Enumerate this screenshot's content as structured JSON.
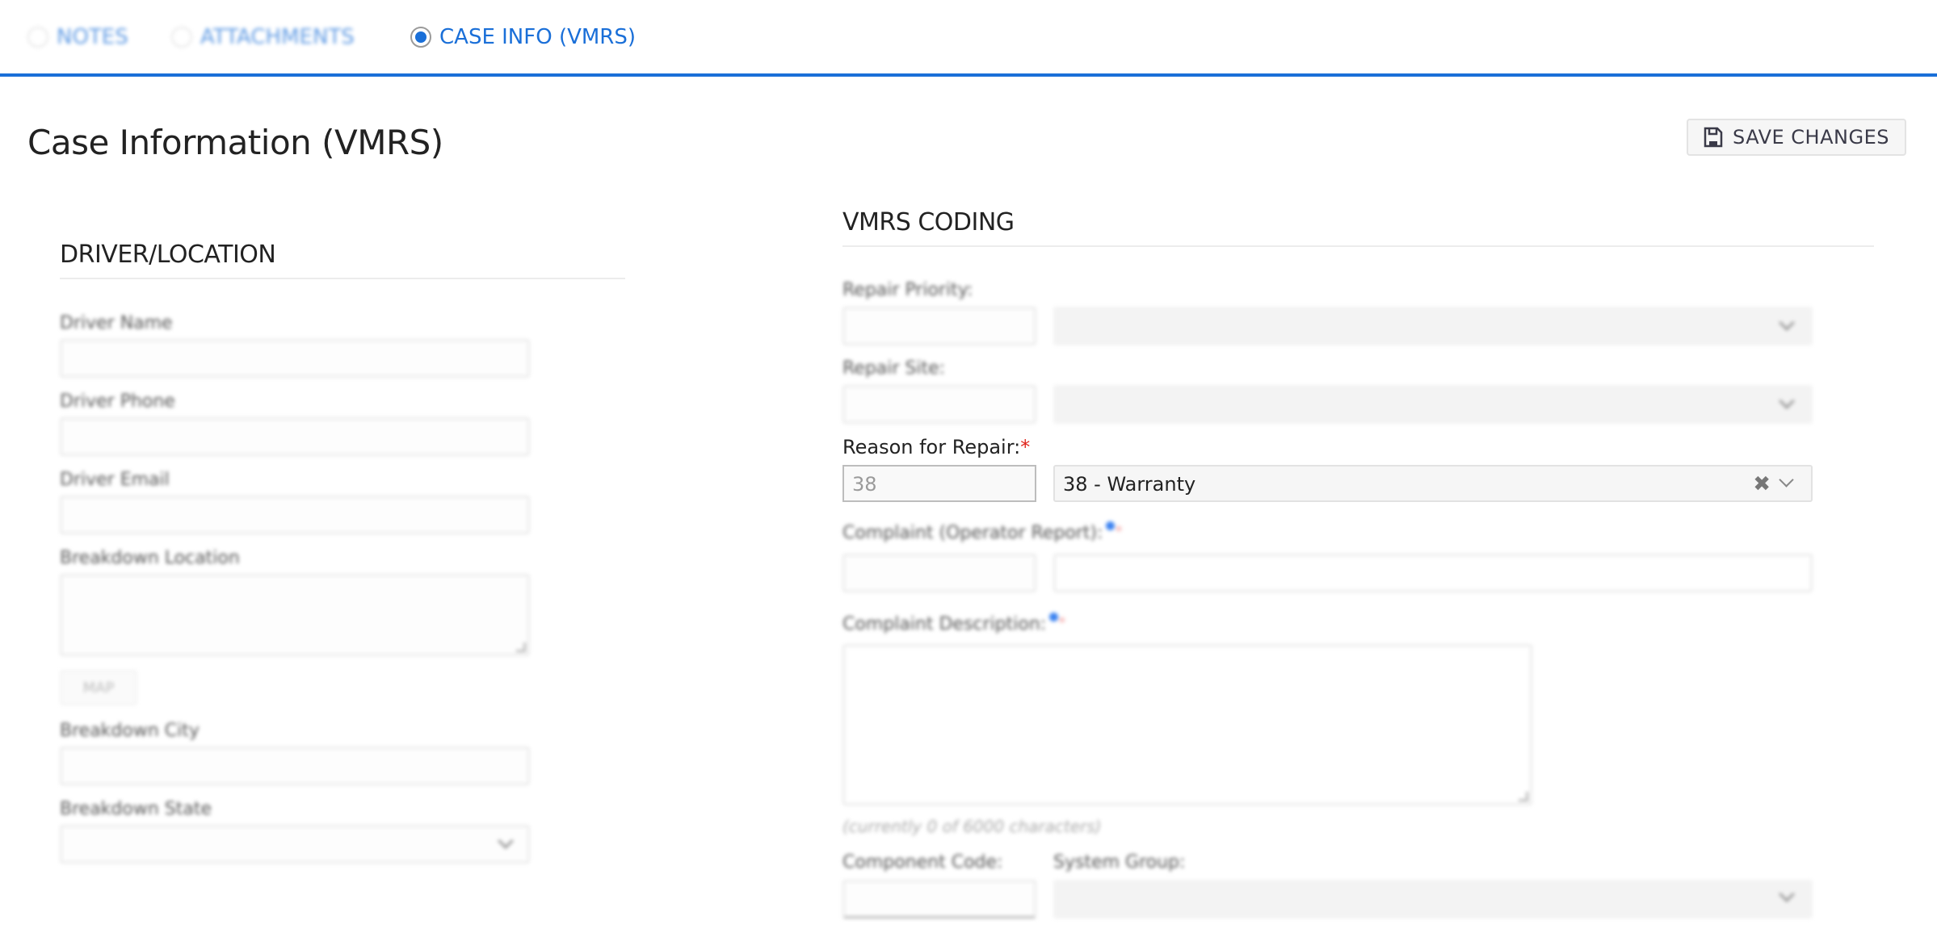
{
  "tabs": [
    {
      "label": "NOTES",
      "selected": false
    },
    {
      "label": "ATTACHMENTS",
      "selected": false
    },
    {
      "label": "CASE INFO (VMRS)",
      "selected": true
    }
  ],
  "page": {
    "title": "Case Information (VMRS)",
    "save_label": "SAVE CHANGES",
    "save_icon": "floppy-disk-icon"
  },
  "driver_location": {
    "title": "DRIVER/LOCATION",
    "fields": {
      "driver_name": {
        "label": "Driver Name",
        "value": ""
      },
      "driver_phone": {
        "label": "Driver Phone",
        "value": ""
      },
      "driver_email": {
        "label": "Driver Email",
        "value": ""
      },
      "breakdown_location": {
        "label": "Breakdown Location",
        "value": ""
      },
      "map_button": "MAP",
      "breakdown_city": {
        "label": "Breakdown City",
        "value": ""
      },
      "breakdown_state": {
        "label": "Breakdown State",
        "value": ""
      }
    }
  },
  "vmrs_coding": {
    "title": "VMRS CODING",
    "repair_priority": {
      "label": "Repair Priority:",
      "code": "",
      "value": ""
    },
    "repair_site": {
      "label": "Repair Site:",
      "code": "",
      "value": ""
    },
    "reason_for_repair": {
      "label": "Reason for Repair:",
      "required_mark": "*",
      "code": "38",
      "value": "38 - Warranty",
      "clear_icon": "✖"
    },
    "complaint_operator_report": {
      "label": "Complaint (Operator Report):",
      "required_mark": "*",
      "code": "",
      "value": ""
    },
    "complaint_description": {
      "label": "Complaint Description:",
      "required_mark": "*",
      "value": "",
      "char_count": "(currently 0 of 6000 characters)"
    },
    "component_code": {
      "label": "Component Code:",
      "value": ""
    },
    "system_group": {
      "label": "System Group:",
      "value": ""
    }
  }
}
